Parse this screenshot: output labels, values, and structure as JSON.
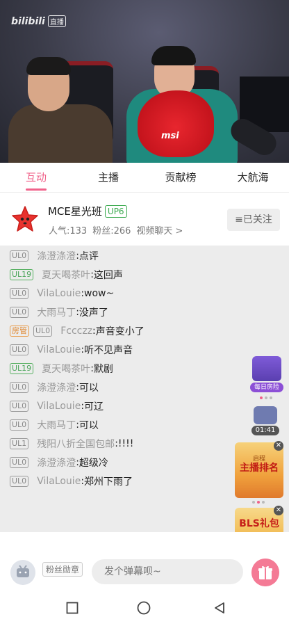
{
  "video": {
    "logo_text": "bilibili",
    "live_label": "直播",
    "brand_text": "msi"
  },
  "tabs": [
    {
      "label": "互动",
      "active": true
    },
    {
      "label": "主播",
      "active": false
    },
    {
      "label": "贡献榜",
      "active": false
    },
    {
      "label": "大航海",
      "active": false
    }
  ],
  "anchor": {
    "name": "MCE星光班",
    "up_level": "UP6",
    "popularity": "人气:133",
    "fans": "粉丝:266",
    "category": "视频聊天 >",
    "follow_label": "≡已关注"
  },
  "chat": [
    {
      "badge": "UL0",
      "badge_color": "gray",
      "user": "涤澄涤澄",
      "text": "点评"
    },
    {
      "badge": "UL19",
      "badge_color": "green",
      "user": "夏天喝茶叶",
      "text": "这回声"
    },
    {
      "badge": "UL0",
      "badge_color": "gray",
      "user": "VilaLouie",
      "text": "wow~"
    },
    {
      "badge": "UL0",
      "badge_color": "gray",
      "user": "大雨马丁",
      "text": "没声了"
    },
    {
      "admin": "房管",
      "badge": "UL0",
      "badge_color": "gray",
      "user": "Fccczz",
      "text": "声音变小了"
    },
    {
      "badge": "UL0",
      "badge_color": "gray",
      "user": "VilaLouie",
      "text": "听不见声音"
    },
    {
      "badge": "UL19",
      "badge_color": "green",
      "user": "夏天喝茶叶",
      "text": "默剧"
    },
    {
      "badge": "UL0",
      "badge_color": "gray",
      "user": "涤澄涤澄",
      "text": "可以"
    },
    {
      "badge": "UL0",
      "badge_color": "gray",
      "user": "VilaLouie",
      "text": "可辽"
    },
    {
      "badge": "UL0",
      "badge_color": "gray",
      "user": "大雨马丁",
      "text": "可以"
    },
    {
      "badge": "UL1",
      "badge_color": "gray",
      "user": "残阳八折全国包邮",
      "text": "!!!!"
    },
    {
      "badge": "UL0",
      "badge_color": "gray",
      "user": "涤澄涤澄",
      "text": "超级冷"
    },
    {
      "badge": "UL0",
      "badge_color": "gray",
      "user": "VilaLouie",
      "text": "郑州下雨了"
    }
  ],
  "widgets": {
    "daily_box": "每日房险",
    "timer": "01:41",
    "rank_top": "启程",
    "rank_title": "主播排名",
    "bls_gift": "BLS礼包",
    "close_glyph": "✕"
  },
  "bottom": {
    "medal_label": "粉丝勋章",
    "input_placeholder": "发个弹幕呗~"
  },
  "colors": {
    "accent": "#f0628a",
    "up_green": "#3aa94e",
    "admin_orange": "#e08a35"
  }
}
